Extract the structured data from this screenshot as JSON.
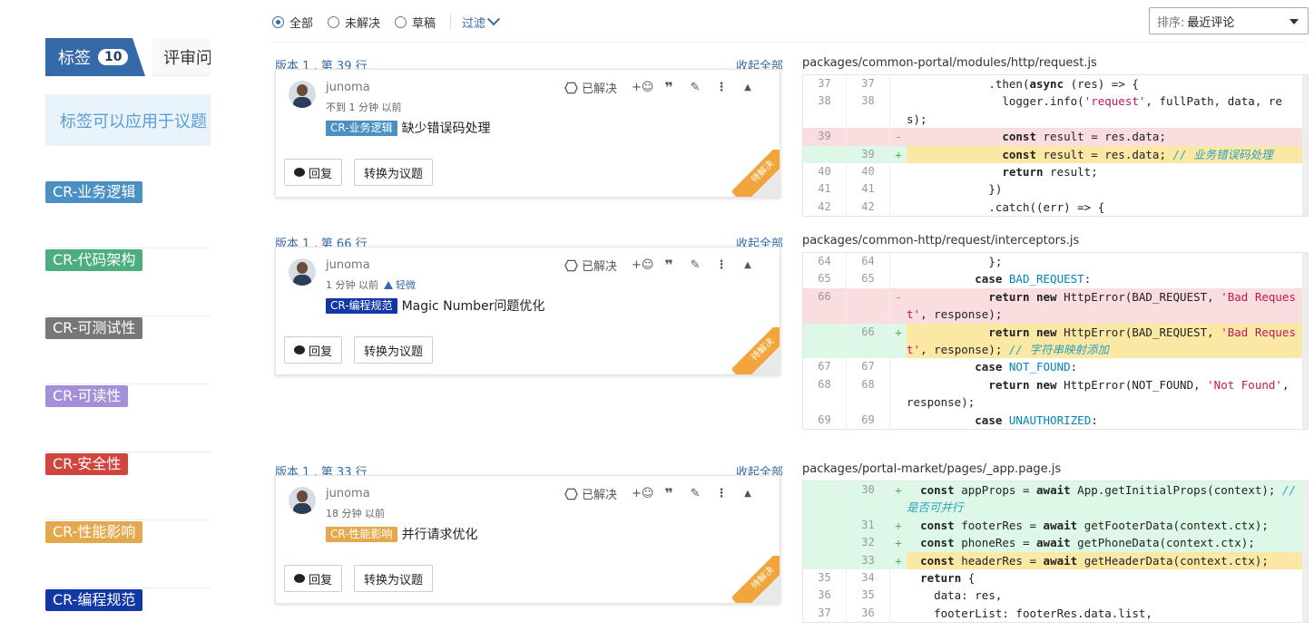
{
  "sidebar": {
    "tab_active_label": "标签",
    "tab_active_count": "10",
    "tab_other_label": "评审问",
    "info_text": "标签可以应用于议题",
    "tags": [
      {
        "label": "CR-业务逻辑",
        "color": "#4a90c2"
      },
      {
        "label": "CR-代码架构",
        "color": "#4cae80"
      },
      {
        "label": "CR-可测试性",
        "color": "#777777"
      },
      {
        "label": "CR-可读性",
        "color": "#a48fd9"
      },
      {
        "label": "CR-安全性",
        "color": "#d0463f"
      },
      {
        "label": "CR-性能影响",
        "color": "#e5a94d"
      },
      {
        "label": "CR-编程规范",
        "color": "#1138a6"
      }
    ]
  },
  "filter": {
    "options": [
      "全部",
      "未解决",
      "草稿"
    ],
    "selected": "全部",
    "filter_link": "过滤"
  },
  "sort": {
    "label": "排序:",
    "value": "最近评论"
  },
  "discussions": [
    {
      "version": "版本 1 , 第 39 行",
      "collapse": "收起全部",
      "file": "packages/common-portal/modules/http/request.js",
      "author": "junoma",
      "time": "不到 1 分钟 以前",
      "severity": "",
      "tag": "CR-业务逻辑",
      "tag_color": "#4a90c2",
      "comment": "缺少错误码处理",
      "resolve": "已解决",
      "reply": "回复",
      "convert": "转换为议题",
      "ribbon": "待解决"
    },
    {
      "version": "版本 1 , 第 66 行",
      "collapse": "收起全部",
      "file": "packages/common-http/request/interceptors.js",
      "author": "junoma",
      "time": "1 分钟 以前",
      "severity": "轻微",
      "tag": "CR-编程规范",
      "tag_color": "#1138a6",
      "comment": "Magic Number问题优化",
      "resolve": "已解决",
      "reply": "回复",
      "convert": "转换为议题",
      "ribbon": "待解决"
    },
    {
      "version": "版本 1 , 第 33 行",
      "collapse": "收起全部",
      "file": "packages/portal-market/pages/_app.page.js",
      "author": "junoma",
      "time": "18 分钟 以前",
      "severity": "",
      "tag": "CR-性能影响",
      "tag_color": "#e5a94d",
      "comment": "并行请求优化",
      "resolve": "已解决",
      "reply": "回复",
      "convert": "转换为议题",
      "ribbon": "待解决"
    }
  ],
  "diffs": [
    {
      "rows": [
        {
          "old": "37",
          "new": "37",
          "type": "ctx",
          "code": "            .then(async (res) => {"
        },
        {
          "old": "38",
          "new": "38",
          "type": "ctx",
          "code": "              logger.info('request', fullPath, data, res);"
        },
        {
          "old": "39",
          "new": "",
          "type": "del",
          "code": "              const result = res.data;"
        },
        {
          "old": "",
          "new": "39",
          "type": "add-hl",
          "code": "              const result = res.data; ",
          "comment": "// 业务错误码处理"
        },
        {
          "old": "40",
          "new": "40",
          "type": "ctx",
          "code": "              return result;"
        },
        {
          "old": "41",
          "new": "41",
          "type": "ctx",
          "code": "            })"
        },
        {
          "old": "42",
          "new": "42",
          "type": "ctx",
          "code": "            .catch((err) => {"
        }
      ]
    },
    {
      "rows": [
        {
          "old": "64",
          "new": "64",
          "type": "ctx",
          "code": "            };"
        },
        {
          "old": "65",
          "new": "65",
          "type": "ctx",
          "code": "          case BAD_REQUEST:"
        },
        {
          "old": "66",
          "new": "",
          "type": "del",
          "code": "            return new HttpError(BAD_REQUEST, 'Bad Request', response);"
        },
        {
          "old": "",
          "new": "66",
          "type": "add-hl",
          "code": "            return new HttpError(BAD_REQUEST, 'Bad Request', response); ",
          "comment": "// 字符串映射添加"
        },
        {
          "old": "67",
          "new": "67",
          "type": "ctx",
          "code": "          case NOT_FOUND:"
        },
        {
          "old": "68",
          "new": "68",
          "type": "ctx",
          "code": "            return new HttpError(NOT_FOUND, 'Not Found', response);"
        },
        {
          "old": "69",
          "new": "69",
          "type": "ctx",
          "code": "          case UNAUTHORIZED:"
        }
      ]
    },
    {
      "rows": [
        {
          "old": "",
          "new": "30",
          "type": "add",
          "code": "  const appProps = await App.getInitialProps(context); ",
          "comment": "// 是否可并行"
        },
        {
          "old": "",
          "new": "31",
          "type": "add",
          "code": "  const footerRes = await getFooterData(context.ctx);"
        },
        {
          "old": "",
          "new": "32",
          "type": "add",
          "code": "  const phoneRes = await getPhoneData(context.ctx);"
        },
        {
          "old": "",
          "new": "33",
          "type": "add-hl",
          "code": "  const headerRes = await getHeaderData(context.ctx);"
        },
        {
          "old": "35",
          "new": "34",
          "type": "ctx",
          "code": "  return {"
        },
        {
          "old": "36",
          "new": "35",
          "type": "ctx",
          "code": "    data: res,"
        },
        {
          "old": "37",
          "new": "36",
          "type": "ctx",
          "code": "    footerList: footerRes.data.list,"
        }
      ]
    }
  ]
}
